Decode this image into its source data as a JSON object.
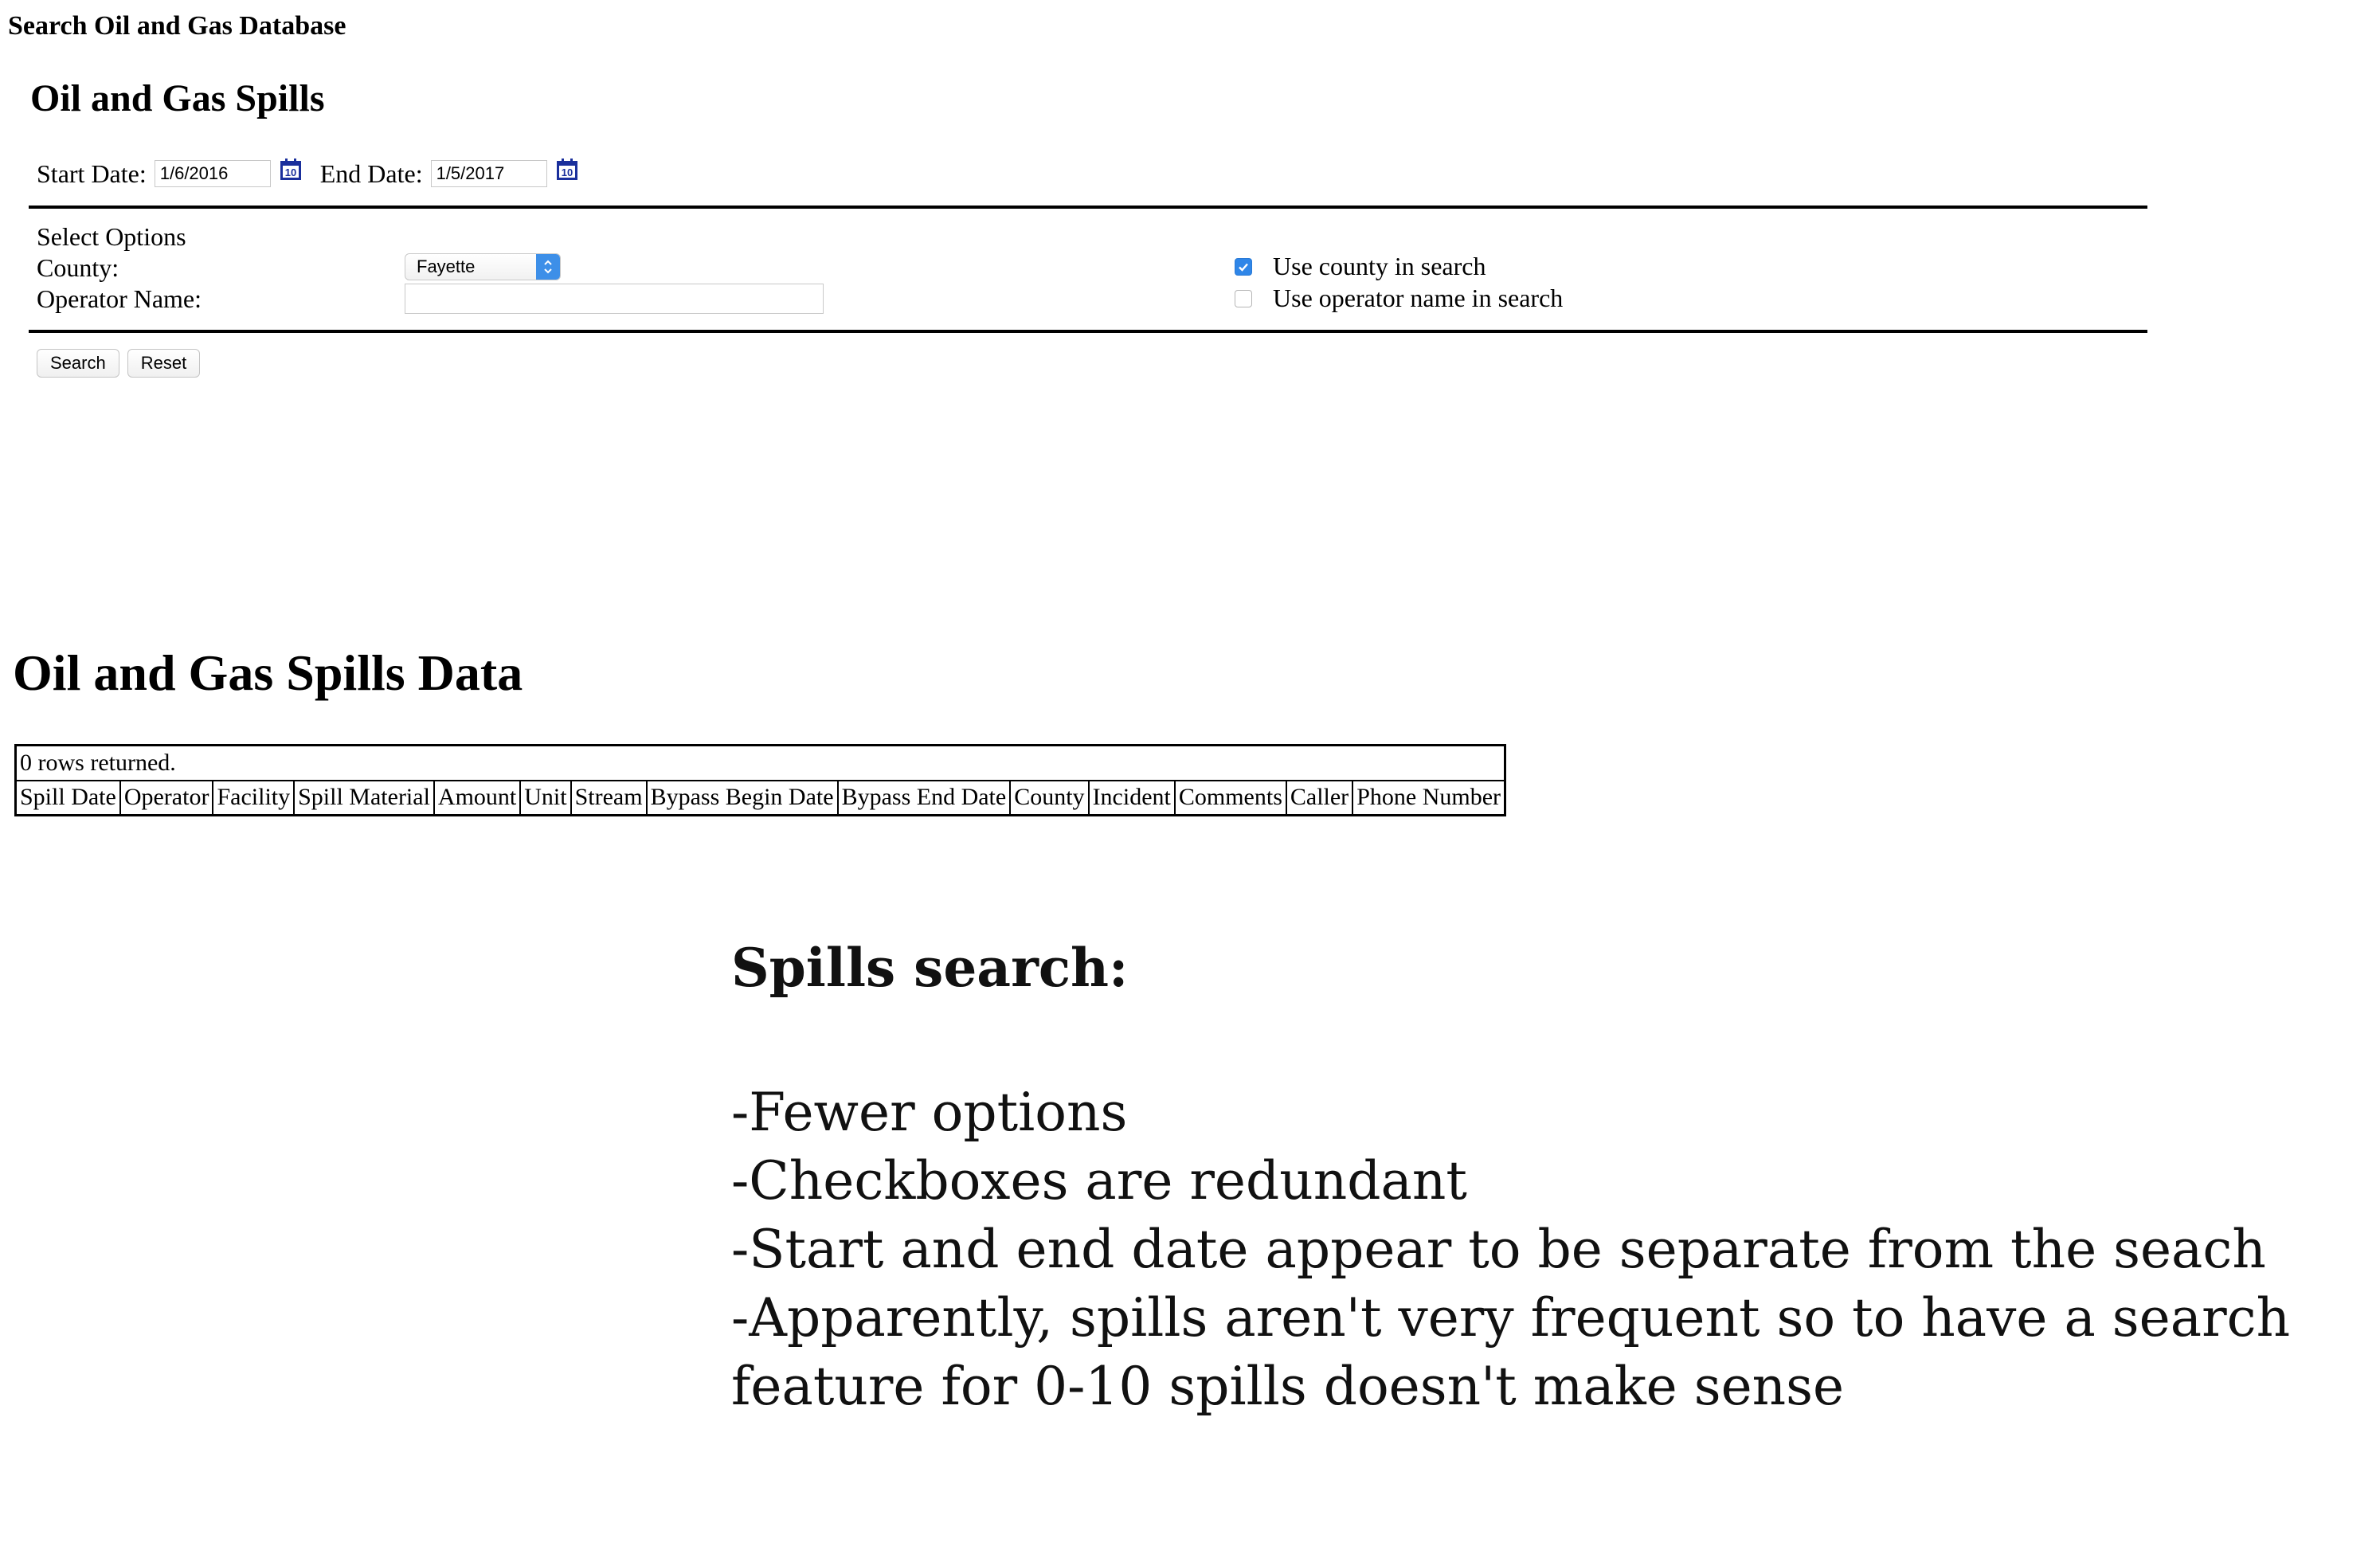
{
  "header": {
    "title": "Search Oil and Gas Database"
  },
  "form": {
    "title": "Oil and Gas Spills",
    "start_date_label": "Start Date:",
    "start_date_value": "1/6/2016",
    "end_date_label": "End Date:",
    "end_date_value": "1/5/2017",
    "select_options_label": "Select Options",
    "county_label": "County:",
    "county_selected": "Fayette",
    "operator_label": "Operator Name:",
    "operator_value": "",
    "use_county_label": "Use county in search",
    "use_county_checked": true,
    "use_operator_label": "Use operator name in search",
    "use_operator_checked": false,
    "search_button": "Search",
    "reset_button": "Reset"
  },
  "results": {
    "title": "Oil and Gas Spills Data",
    "rows_returned": "0 rows returned.",
    "columns": [
      "Spill Date",
      "Operator",
      "Facility",
      "Spill Material",
      "Amount",
      "Unit",
      "Stream",
      "Bypass Begin Date",
      "Bypass End Date",
      "County",
      "Incident",
      "Comments",
      "Caller",
      "Phone Number"
    ]
  },
  "notes": {
    "title": "Spills search:",
    "lines": [
      "-Fewer options",
      "-Checkboxes are redundant",
      "-Start and end date appear to be separate from the seach",
      "-Apparently, spills aren't very frequent so to have a search",
      "feature for 0-10 spills doesn't make sense"
    ]
  },
  "colors": {
    "accent_blue": "#2f86e8",
    "calendar_icon": "#1a2f9c"
  },
  "icons": {
    "calendar": "calendar-icon",
    "select_arrow": "select-arrow-icon",
    "checkmark": "checkmark-icon"
  }
}
